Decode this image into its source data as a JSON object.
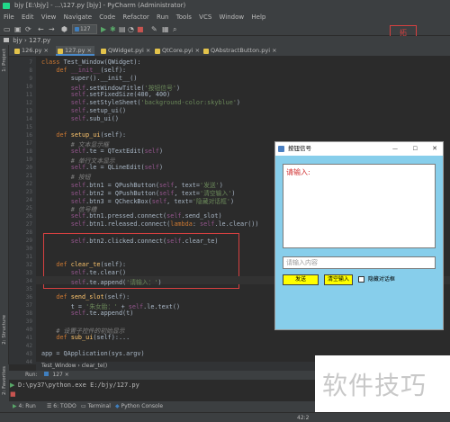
{
  "window": {
    "title": "bjy [E:\\bjy] - ...\\127.py [bjy] - PyCharm (Administrator)",
    "watermark_box_glyph": "拓"
  },
  "menu": [
    "File",
    "Edit",
    "View",
    "Navigate",
    "Code",
    "Refactor",
    "Run",
    "Tools",
    "VCS",
    "Window",
    "Help"
  ],
  "toolbar": {
    "run_config": "127"
  },
  "breadcrumb": {
    "project": "bjy",
    "file": "127.py"
  },
  "tabs": [
    {
      "label": "126.py",
      "active": false
    },
    {
      "label": "127.py",
      "active": true
    },
    {
      "label": "QWidget.pyi",
      "active": false
    },
    {
      "label": "QtCore.pyi",
      "active": false
    },
    {
      "label": "QAbstractButton.pyi",
      "active": false
    }
  ],
  "left_tools": {
    "project": "1: Project",
    "structure": "2: Structure",
    "favorites": "2: Favorites"
  },
  "line_numbers": [
    "",
    "7",
    "8",
    "9",
    "10",
    "11",
    "12",
    "13",
    "14",
    "15",
    "16",
    "17",
    "18",
    "19",
    "20",
    "21",
    "22",
    "23",
    "24",
    "25",
    "26",
    "27",
    "28",
    "29",
    "30",
    "31",
    "32",
    "33",
    "34",
    "35",
    "36",
    "37",
    "38",
    "39",
    "40",
    "41",
    "42",
    "43",
    "44",
    "45",
    "46",
    "47",
    "48",
    "49",
    "50",
    "51"
  ],
  "code": {
    "class_kw": "class ",
    "class_name": "Test_Window",
    "class_rest": "(QWidget):",
    "init_def": "def ",
    "init_name": "__init__",
    "init_self": "(self):",
    "super_line": "super().__init__()",
    "l_title_a": "self",
    "l_title_b": ".setWindowTitle(",
    "l_title_s": "'按钮信号'",
    "l_title_c": ")",
    "l_fixed_a": "self",
    "l_fixed_b": ".setFixedSize(400, 400)",
    "l_style_a": "self",
    "l_style_b": ".setStyleSheet(",
    "l_style_s": "'background-color:skyblue'",
    "l_style_c": ")",
    "l_setup_a": "self",
    "l_setup_b": ".setup_ui()",
    "l_sub_a": "self",
    "l_sub_b": ".sub_ui()",
    "setup_def": "def ",
    "setup_name": "setup_ui",
    "setup_self": "(self):",
    "cm_textedit": "# 文本显示框",
    "te_a": "self",
    "te_b": ".te = QTextEdit(",
    "te_c": "self",
    "te_d": ")",
    "cm_lineedit": "# 单行文本显示",
    "le_a": "self",
    "le_b": ".le = QLineEdit(",
    "le_c": "self",
    "le_d": ")",
    "cm_button": "# 按钮",
    "b1_a": "self",
    "b1_b": ".btn1 = QPushButton(",
    "b1_c": "self",
    "b1_d": ", text=",
    "b1_s": "'发送'",
    "b1_e": ")",
    "b2_a": "self",
    "b2_b": ".btn2 = QPushButton(",
    "b2_c": "self",
    "b2_d": ", text=",
    "b2_s": "'清空输入'",
    "b2_e": ")",
    "b3_a": "self",
    "b3_b": ".btn3 = QCheckBox(",
    "b3_c": "self",
    "b3_d": ", text=",
    "b3_s": "'隐藏对话框'",
    "b3_e": ")",
    "cm_signal": "# 信号槽",
    "p1_a": "self",
    "p1_b": ".btn1.pressed.connect(",
    "p1_c": "self",
    "p1_d": ".send_slot)",
    "r1_a": "self",
    "r1_b": ".btn1.released.connect(",
    "r1_k": "lambda",
    "r1_c": ": ",
    "r1_d": "self",
    "r1_e": ".le.clear())",
    "c2_a": "self",
    "c2_b": ".btn2.clicked.connect(",
    "c2_c": "self",
    "c2_d": ".clear_te)",
    "clear_def": "def ",
    "clear_name": "clear_te",
    "clear_self": "(self):",
    "ct1_a": "self",
    "ct1_b": ".te.clear()",
    "ct2_a": "self",
    "ct2_b": ".te.append(",
    "ct2_s": "'请输入：'",
    "ct2_c": ")",
    "send_def": "def ",
    "send_name": "send_slot",
    "send_self": "(self):",
    "t_a": "t = ",
    "t_s": "'朱女胎：'",
    "t_b": " + ",
    "t_c": "self",
    "t_d": ".le.text()",
    "tea_a": "self",
    "tea_b": ".te.append(t)",
    "cm_init": "# 设置子控件的初始显示",
    "sub_def": "def ",
    "sub_name": "sub_ui",
    "sub_self": "(self):...",
    "app_a": "app = QApplication(sys.argv)"
  },
  "editor_breadcrumb": {
    "class": "Test_Window",
    "sep": " › ",
    "method": "clear_te()"
  },
  "run_panel": {
    "tab_label": "Run:",
    "config": "127",
    "command": "D:\\py37\\python.exe E:/bjy/127.py"
  },
  "bottom_tabs": [
    "4: Run",
    "6: TODO",
    "Terminal",
    "Python Console"
  ],
  "status": {
    "position": "42:2"
  },
  "qt_window": {
    "title": "按钮信号",
    "textedit_text": "请输入:",
    "lineedit_placeholder": "请输入内容",
    "send_label": "发送",
    "clear_label": "清空输入",
    "checkbox_label": "隐藏对话框",
    "minimize": "—",
    "maximize": "☐",
    "close": "✕"
  },
  "watermark": {
    "text": "软件技巧"
  },
  "colors": {
    "skyblue": "#87ceeb",
    "button": "#ffff00",
    "highlight_red": "#d64040"
  }
}
